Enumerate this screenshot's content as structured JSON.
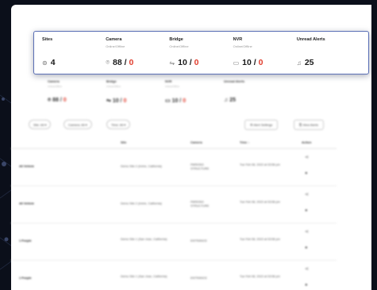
{
  "stats": [
    {
      "title": "Sites",
      "subtitle": "",
      "icon": "location-icon",
      "value": "4",
      "offline": ""
    },
    {
      "title": "Camera",
      "subtitle": "Online/Offline",
      "icon": "camera-icon",
      "value": "88",
      "offline": "0"
    },
    {
      "title": "Bridge",
      "subtitle": "Online/Offline",
      "icon": "bridge-icon",
      "value": "10",
      "offline": "0"
    },
    {
      "title": "NVR",
      "subtitle": "Online/Offline",
      "icon": "nvr-icon",
      "value": "10",
      "offline": "0"
    },
    {
      "title": "Unread Alerts",
      "subtitle": "",
      "icon": "bell-icon",
      "value": "25",
      "offline": ""
    }
  ],
  "ghost_stats": [
    {
      "title": "Camera",
      "subtitle": "Online/Offline",
      "value": "88",
      "offline": "0"
    },
    {
      "title": "Bridge",
      "subtitle": "Online/Offline",
      "value": "10",
      "offline": "0"
    },
    {
      "title": "NVR",
      "subtitle": "Online/Offline",
      "value": "10",
      "offline": "0"
    },
    {
      "title": "Unread Alerts",
      "subtitle": "",
      "value": "25",
      "offline": ""
    }
  ],
  "filters": {
    "chips": [
      "Site: All",
      "Camera: All",
      "Time: All"
    ],
    "alert_settings": "Alert Settings",
    "view_alerts": "View Alerts"
  },
  "table": {
    "columns": [
      "Site",
      "Camera",
      "Time"
    ],
    "col_time_sort": "Time ↓",
    "col_action": "Action",
    "rows": [
      {
        "type": "All Vehicle",
        "site": "Demo Site 2 (Irvine, California)",
        "camera": "PARKING STRUCTURE",
        "time": "Tue Feb 08, 2022 at 03:56 pm"
      },
      {
        "type": "All Vehicle",
        "site": "Demo Site 2 (Irvine, California)",
        "camera": "PARKING STRUCTURE",
        "time": "Tue Feb 08, 2022 at 03:56 pm"
      },
      {
        "type": "1 People",
        "site": "Demo Site 1 (San Jose, California)",
        "camera": "ENTRANCE",
        "time": "Tue Feb 08, 2022 at 03:56 pm"
      },
      {
        "type": "1 People",
        "site": "Demo Site 1 (San Jose, California)",
        "camera": "ENTRANCE",
        "time": "Tue Feb 08, 2022 at 03:56 pm"
      }
    ]
  }
}
